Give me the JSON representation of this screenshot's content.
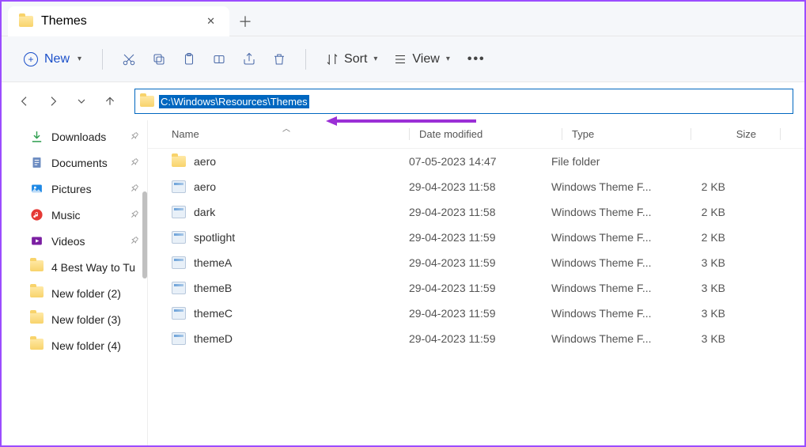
{
  "tab": {
    "title": "Themes"
  },
  "toolbar": {
    "new_label": "New",
    "sort_label": "Sort",
    "view_label": "View"
  },
  "address": {
    "path": "C:\\Windows\\Resources\\Themes"
  },
  "sidebar": {
    "items": [
      {
        "label": "Downloads",
        "icon": "download",
        "pinned": true
      },
      {
        "label": "Documents",
        "icon": "document",
        "pinned": true
      },
      {
        "label": "Pictures",
        "icon": "pictures",
        "pinned": true
      },
      {
        "label": "Music",
        "icon": "music",
        "pinned": true
      },
      {
        "label": "Videos",
        "icon": "videos",
        "pinned": true
      },
      {
        "label": "4 Best Way to Tu",
        "icon": "folder",
        "pinned": false
      },
      {
        "label": "New folder (2)",
        "icon": "folder",
        "pinned": false
      },
      {
        "label": "New folder (3)",
        "icon": "folder",
        "pinned": false
      },
      {
        "label": "New folder (4)",
        "icon": "folder",
        "pinned": false
      }
    ]
  },
  "columns": {
    "name": "Name",
    "date": "Date modified",
    "type": "Type",
    "size": "Size"
  },
  "files": [
    {
      "name": "aero",
      "date": "07-05-2023 14:47",
      "type": "File folder",
      "size": "",
      "kind": "folder"
    },
    {
      "name": "aero",
      "date": "29-04-2023 11:58",
      "type": "Windows Theme F...",
      "size": "2 KB",
      "kind": "theme"
    },
    {
      "name": "dark",
      "date": "29-04-2023 11:58",
      "type": "Windows Theme F...",
      "size": "2 KB",
      "kind": "theme"
    },
    {
      "name": "spotlight",
      "date": "29-04-2023 11:59",
      "type": "Windows Theme F...",
      "size": "2 KB",
      "kind": "theme"
    },
    {
      "name": "themeA",
      "date": "29-04-2023 11:59",
      "type": "Windows Theme F...",
      "size": "3 KB",
      "kind": "theme"
    },
    {
      "name": "themeB",
      "date": "29-04-2023 11:59",
      "type": "Windows Theme F...",
      "size": "3 KB",
      "kind": "theme"
    },
    {
      "name": "themeC",
      "date": "29-04-2023 11:59",
      "type": "Windows Theme F...",
      "size": "3 KB",
      "kind": "theme"
    },
    {
      "name": "themeD",
      "date": "29-04-2023 11:59",
      "type": "Windows Theme F...",
      "size": "3 KB",
      "kind": "theme"
    }
  ]
}
